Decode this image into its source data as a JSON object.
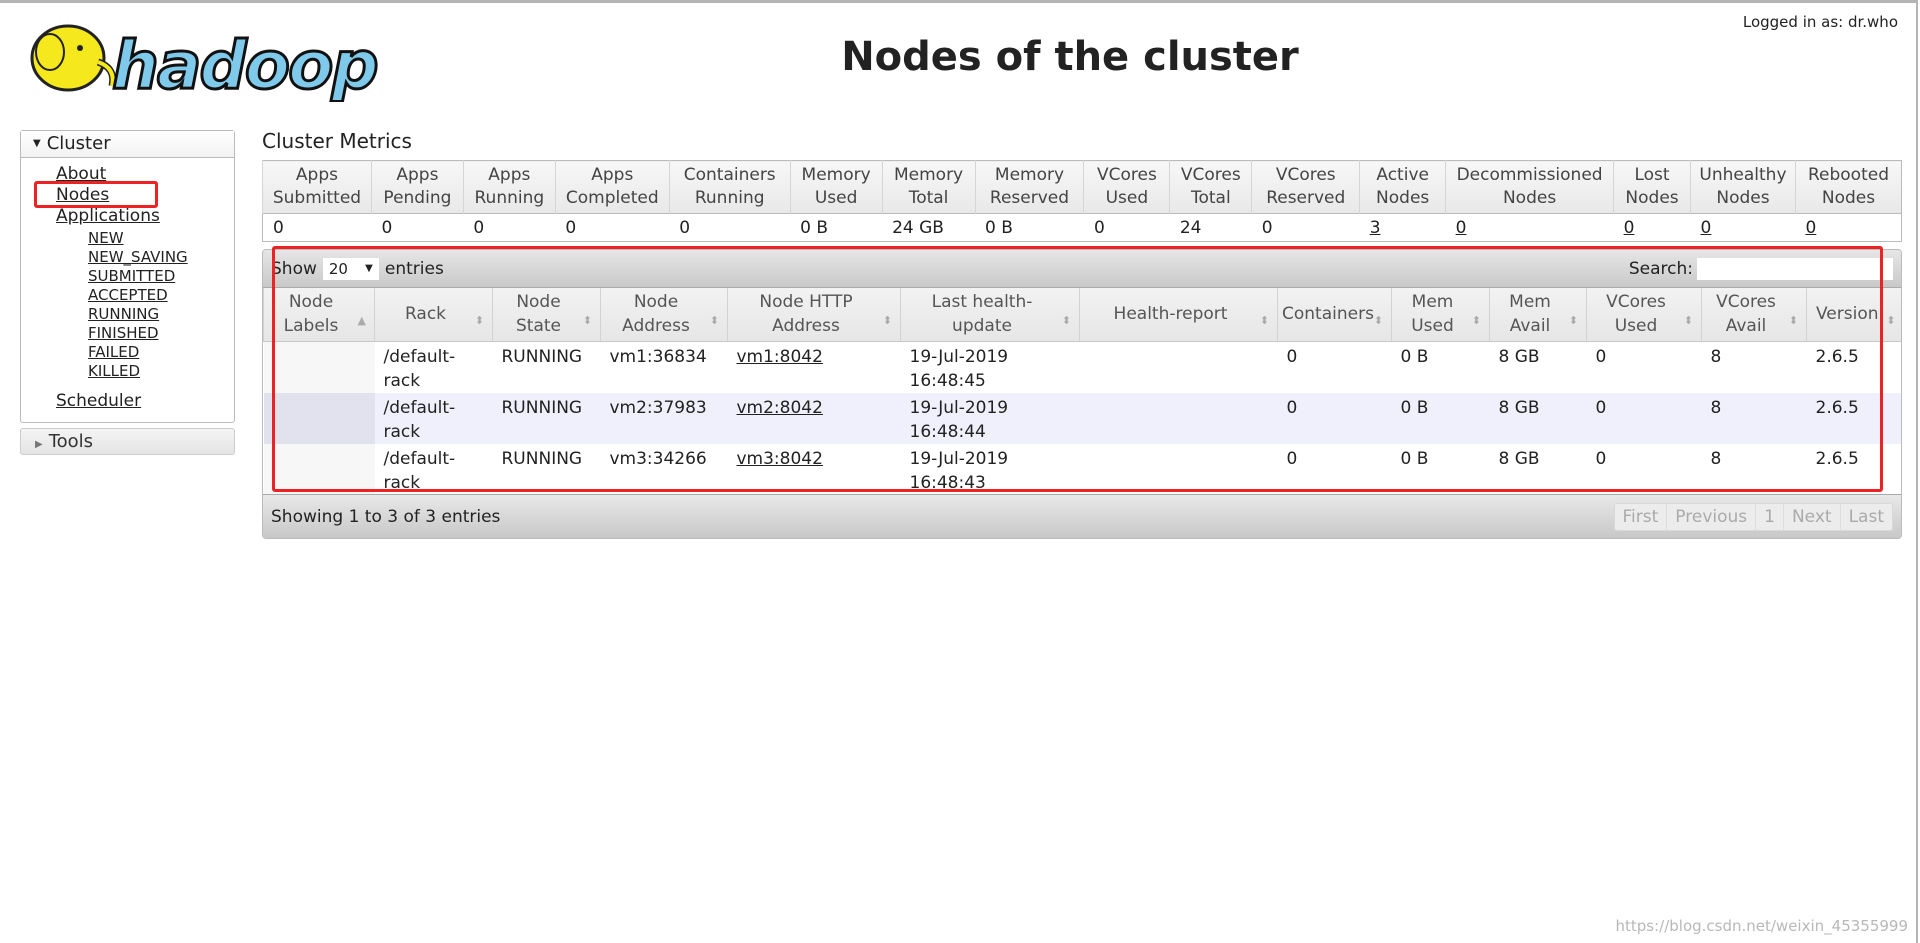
{
  "header": {
    "title": "Nodes of the cluster",
    "logged_in": "Logged in as: dr.who",
    "logo_text": "hadoop"
  },
  "sidebar": {
    "cluster_label": "Cluster",
    "items": [
      {
        "label": "About"
      },
      {
        "label": "Nodes"
      },
      {
        "label": "Applications"
      }
    ],
    "app_states": [
      "NEW",
      "NEW_SAVING",
      "SUBMITTED",
      "ACCEPTED",
      "RUNNING",
      "FINISHED",
      "FAILED",
      "KILLED"
    ],
    "scheduler": "Scheduler",
    "tools_label": "Tools"
  },
  "metrics": {
    "heading": "Cluster Metrics",
    "headers": [
      [
        "Apps",
        "Submitted"
      ],
      [
        "Apps",
        "Pending"
      ],
      [
        "Apps",
        "Running"
      ],
      [
        "Apps",
        "Completed"
      ],
      [
        "Containers",
        "Running"
      ],
      [
        "Memory",
        "Used"
      ],
      [
        "Memory",
        "Total"
      ],
      [
        "Memory",
        "Reserved"
      ],
      [
        "VCores",
        "Used"
      ],
      [
        "VCores",
        "Total"
      ],
      [
        "VCores",
        "Reserved"
      ],
      [
        "Active",
        "Nodes"
      ],
      [
        "Decommissioned",
        "Nodes"
      ],
      [
        "Lost",
        "Nodes"
      ],
      [
        "Unhealthy",
        "Nodes"
      ],
      [
        "Rebooted",
        "Nodes"
      ]
    ],
    "values": [
      "0",
      "0",
      "0",
      "0",
      "0",
      "0 B",
      "24 GB",
      "0 B",
      "0",
      "24",
      "0",
      "3",
      "0",
      "0",
      "0",
      "0"
    ]
  },
  "table": {
    "show_label": "Show",
    "entries_label": "entries",
    "page_size": "20",
    "search_label": "Search:",
    "search_value": "",
    "columns": [
      [
        "Node",
        "Labels"
      ],
      [
        "Rack",
        ""
      ],
      [
        "Node",
        "State"
      ],
      [
        "Node",
        "Address"
      ],
      [
        "Node HTTP",
        "Address"
      ],
      [
        "Last health-",
        "update"
      ],
      [
        "Health-report",
        ""
      ],
      [
        "Containers",
        ""
      ],
      [
        "Mem",
        "Used"
      ],
      [
        "Mem",
        "Avail"
      ],
      [
        "VCores",
        "Used"
      ],
      [
        "VCores",
        "Avail"
      ],
      [
        "Version",
        ""
      ]
    ],
    "rows": [
      {
        "labels": "",
        "rack": "/default-rack",
        "state": "RUNNING",
        "address": "vm1:36834",
        "http": "vm1:8042",
        "health_update": "19-Jul-2019 16:48:45",
        "health_report": "",
        "containers": "0",
        "mem_used": "0 B",
        "mem_avail": "8 GB",
        "vcores_used": "0",
        "vcores_avail": "8",
        "version": "2.6.5"
      },
      {
        "labels": "",
        "rack": "/default-rack",
        "state": "RUNNING",
        "address": "vm2:37983",
        "http": "vm2:8042",
        "health_update": "19-Jul-2019 16:48:44",
        "health_report": "",
        "containers": "0",
        "mem_used": "0 B",
        "mem_avail": "8 GB",
        "vcores_used": "0",
        "vcores_avail": "8",
        "version": "2.6.5"
      },
      {
        "labels": "",
        "rack": "/default-rack",
        "state": "RUNNING",
        "address": "vm3:34266",
        "http": "vm3:8042",
        "health_update": "19-Jul-2019 16:48:43",
        "health_report": "",
        "containers": "0",
        "mem_used": "0 B",
        "mem_avail": "8 GB",
        "vcores_used": "0",
        "vcores_avail": "8",
        "version": "2.6.5"
      }
    ],
    "info": "Showing 1 to 3 of 3 entries",
    "pager": [
      "First",
      "Previous",
      "1",
      "Next",
      "Last"
    ]
  },
  "watermark": "https://blog.csdn.net/weixin_45355999",
  "colors": {
    "highlight": "#ee2222",
    "logo_blue": "#7fc9ea",
    "logo_yellow": "#f5e81c"
  }
}
